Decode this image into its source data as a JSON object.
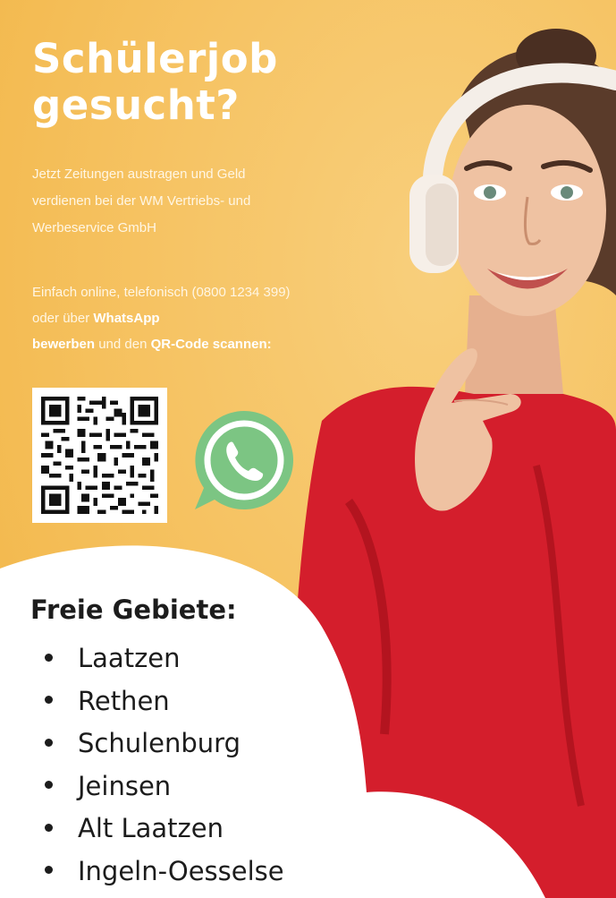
{
  "headline": {
    "line1": "Schülerjob",
    "line2": "gesucht?"
  },
  "intro": {
    "line1": "Jetzt Zeitungen austragen und Geld",
    "line2": "verdienen bei der WM Vertriebs- und",
    "line3": "Werbeservice GmbH"
  },
  "apply": {
    "line1": "Einfach online, telefonisch (0800 1234 399)",
    "line2_prefix": "oder über ",
    "line2_bold": "WhatsApp",
    "line3_bold1": "bewerben",
    "line3_middle": " und den ",
    "line3_bold2": "QR-Code scannen:"
  },
  "qr_code": {
    "icon": "qr-code-icon"
  },
  "whatsapp": {
    "icon": "whatsapp-icon",
    "color": "#7cc583"
  },
  "areas": {
    "title": "Freie Gebiete:",
    "items": [
      "Laatzen",
      "Rethen",
      "Schulenburg",
      "Jeinsen",
      "Alt Laatzen",
      "Ingeln-Oesselse"
    ]
  },
  "colors": {
    "background": "#f6c363",
    "sweater": "#d41e2c",
    "text_dark": "#1c1c1c"
  }
}
